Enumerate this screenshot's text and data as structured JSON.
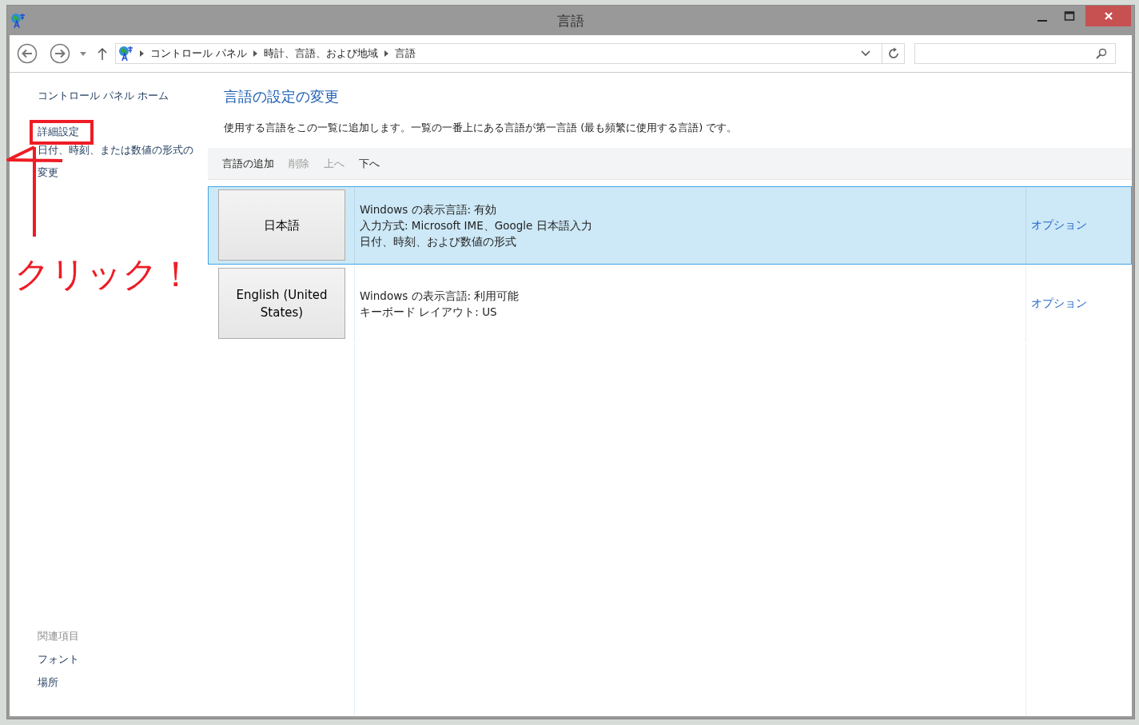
{
  "window": {
    "title": "言語"
  },
  "address_bar": {
    "breadcrumbs": [
      "コントロール パネル",
      "時計、言語、および地域",
      "言語"
    ]
  },
  "sidebar": {
    "items": [
      "コントロール パネル ホーム",
      "詳細設定",
      "日付、時刻、または数値の形式の変更"
    ],
    "related_heading": "関連項目",
    "related_items": [
      "フォント",
      "場所"
    ]
  },
  "main": {
    "heading": "言語の設定の変更",
    "description": "使用する言語をこの一覧に追加します。一覧の一番上にある言語が第一言語 (最も頻繁に使用する言語) です。",
    "toolbar": [
      {
        "label": "言語の追加",
        "disabled": false
      },
      {
        "label": "削除",
        "disabled": true
      },
      {
        "label": "上へ",
        "disabled": true
      },
      {
        "label": "下へ",
        "disabled": false
      }
    ],
    "languages": [
      {
        "name": "日本語",
        "selected": true,
        "details": [
          "Windows の表示言語: 有効",
          "入力方式: Microsoft IME、Google 日本語入力",
          "日付、時刻、および数値の形式"
        ],
        "options": "オプション"
      },
      {
        "name": "English (United States)",
        "selected": false,
        "details": [
          "Windows の表示言語: 利用可能",
          "キーボード レイアウト: US"
        ],
        "options": "オプション"
      }
    ]
  },
  "annotation": {
    "text": "クリック！"
  }
}
